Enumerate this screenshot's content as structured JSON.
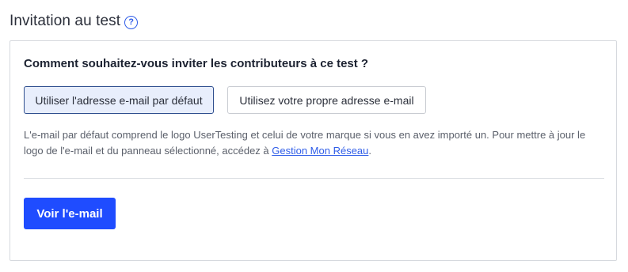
{
  "header": {
    "title": "Invitation au test",
    "help_icon": "question-circle-icon",
    "help_glyph": "?"
  },
  "card": {
    "question": "Comment souhaitez-vous inviter les contributeurs à ce test ?",
    "options": [
      {
        "label": "Utiliser l'adresse e-mail par défaut",
        "selected": true
      },
      {
        "label": "Utilisez votre propre adresse e-mail",
        "selected": false
      }
    ],
    "help_text_before": "L'e-mail par défaut comprend le logo UserTesting et celui de votre marque si vous en avez importé un. Pour mettre à jour le logo de l'e-mail et du panneau sélectionné, accédez à ",
    "help_link": "Gestion Mon Réseau",
    "help_text_after": ".",
    "primary_button": "Voir l'e-mail"
  },
  "colors": {
    "accent": "#1f4cff",
    "link": "#2f5de8",
    "selected_bg": "#e8eefc"
  }
}
